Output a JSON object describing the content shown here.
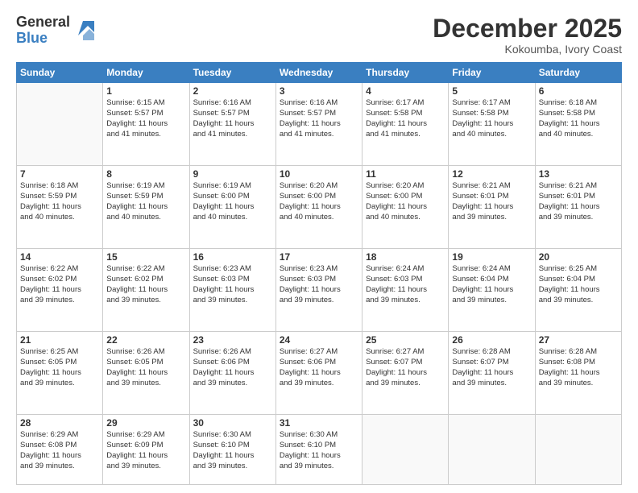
{
  "logo": {
    "general": "General",
    "blue": "Blue"
  },
  "header": {
    "month": "December 2025",
    "location": "Kokoumba, Ivory Coast"
  },
  "days_of_week": [
    "Sunday",
    "Monday",
    "Tuesday",
    "Wednesday",
    "Thursday",
    "Friday",
    "Saturday"
  ],
  "weeks": [
    [
      {
        "day": "",
        "lines": []
      },
      {
        "day": "1",
        "lines": [
          "Sunrise: 6:15 AM",
          "Sunset: 5:57 PM",
          "Daylight: 11 hours",
          "and 41 minutes."
        ]
      },
      {
        "day": "2",
        "lines": [
          "Sunrise: 6:16 AM",
          "Sunset: 5:57 PM",
          "Daylight: 11 hours",
          "and 41 minutes."
        ]
      },
      {
        "day": "3",
        "lines": [
          "Sunrise: 6:16 AM",
          "Sunset: 5:57 PM",
          "Daylight: 11 hours",
          "and 41 minutes."
        ]
      },
      {
        "day": "4",
        "lines": [
          "Sunrise: 6:17 AM",
          "Sunset: 5:58 PM",
          "Daylight: 11 hours",
          "and 41 minutes."
        ]
      },
      {
        "day": "5",
        "lines": [
          "Sunrise: 6:17 AM",
          "Sunset: 5:58 PM",
          "Daylight: 11 hours",
          "and 40 minutes."
        ]
      },
      {
        "day": "6",
        "lines": [
          "Sunrise: 6:18 AM",
          "Sunset: 5:58 PM",
          "Daylight: 11 hours",
          "and 40 minutes."
        ]
      }
    ],
    [
      {
        "day": "7",
        "lines": [
          "Sunrise: 6:18 AM",
          "Sunset: 5:59 PM",
          "Daylight: 11 hours",
          "and 40 minutes."
        ]
      },
      {
        "day": "8",
        "lines": [
          "Sunrise: 6:19 AM",
          "Sunset: 5:59 PM",
          "Daylight: 11 hours",
          "and 40 minutes."
        ]
      },
      {
        "day": "9",
        "lines": [
          "Sunrise: 6:19 AM",
          "Sunset: 6:00 PM",
          "Daylight: 11 hours",
          "and 40 minutes."
        ]
      },
      {
        "day": "10",
        "lines": [
          "Sunrise: 6:20 AM",
          "Sunset: 6:00 PM",
          "Daylight: 11 hours",
          "and 40 minutes."
        ]
      },
      {
        "day": "11",
        "lines": [
          "Sunrise: 6:20 AM",
          "Sunset: 6:00 PM",
          "Daylight: 11 hours",
          "and 40 minutes."
        ]
      },
      {
        "day": "12",
        "lines": [
          "Sunrise: 6:21 AM",
          "Sunset: 6:01 PM",
          "Daylight: 11 hours",
          "and 39 minutes."
        ]
      },
      {
        "day": "13",
        "lines": [
          "Sunrise: 6:21 AM",
          "Sunset: 6:01 PM",
          "Daylight: 11 hours",
          "and 39 minutes."
        ]
      }
    ],
    [
      {
        "day": "14",
        "lines": [
          "Sunrise: 6:22 AM",
          "Sunset: 6:02 PM",
          "Daylight: 11 hours",
          "and 39 minutes."
        ]
      },
      {
        "day": "15",
        "lines": [
          "Sunrise: 6:22 AM",
          "Sunset: 6:02 PM",
          "Daylight: 11 hours",
          "and 39 minutes."
        ]
      },
      {
        "day": "16",
        "lines": [
          "Sunrise: 6:23 AM",
          "Sunset: 6:03 PM",
          "Daylight: 11 hours",
          "and 39 minutes."
        ]
      },
      {
        "day": "17",
        "lines": [
          "Sunrise: 6:23 AM",
          "Sunset: 6:03 PM",
          "Daylight: 11 hours",
          "and 39 minutes."
        ]
      },
      {
        "day": "18",
        "lines": [
          "Sunrise: 6:24 AM",
          "Sunset: 6:03 PM",
          "Daylight: 11 hours",
          "and 39 minutes."
        ]
      },
      {
        "day": "19",
        "lines": [
          "Sunrise: 6:24 AM",
          "Sunset: 6:04 PM",
          "Daylight: 11 hours",
          "and 39 minutes."
        ]
      },
      {
        "day": "20",
        "lines": [
          "Sunrise: 6:25 AM",
          "Sunset: 6:04 PM",
          "Daylight: 11 hours",
          "and 39 minutes."
        ]
      }
    ],
    [
      {
        "day": "21",
        "lines": [
          "Sunrise: 6:25 AM",
          "Sunset: 6:05 PM",
          "Daylight: 11 hours",
          "and 39 minutes."
        ]
      },
      {
        "day": "22",
        "lines": [
          "Sunrise: 6:26 AM",
          "Sunset: 6:05 PM",
          "Daylight: 11 hours",
          "and 39 minutes."
        ]
      },
      {
        "day": "23",
        "lines": [
          "Sunrise: 6:26 AM",
          "Sunset: 6:06 PM",
          "Daylight: 11 hours",
          "and 39 minutes."
        ]
      },
      {
        "day": "24",
        "lines": [
          "Sunrise: 6:27 AM",
          "Sunset: 6:06 PM",
          "Daylight: 11 hours",
          "and 39 minutes."
        ]
      },
      {
        "day": "25",
        "lines": [
          "Sunrise: 6:27 AM",
          "Sunset: 6:07 PM",
          "Daylight: 11 hours",
          "and 39 minutes."
        ]
      },
      {
        "day": "26",
        "lines": [
          "Sunrise: 6:28 AM",
          "Sunset: 6:07 PM",
          "Daylight: 11 hours",
          "and 39 minutes."
        ]
      },
      {
        "day": "27",
        "lines": [
          "Sunrise: 6:28 AM",
          "Sunset: 6:08 PM",
          "Daylight: 11 hours",
          "and 39 minutes."
        ]
      }
    ],
    [
      {
        "day": "28",
        "lines": [
          "Sunrise: 6:29 AM",
          "Sunset: 6:08 PM",
          "Daylight: 11 hours",
          "and 39 minutes."
        ]
      },
      {
        "day": "29",
        "lines": [
          "Sunrise: 6:29 AM",
          "Sunset: 6:09 PM",
          "Daylight: 11 hours",
          "and 39 minutes."
        ]
      },
      {
        "day": "30",
        "lines": [
          "Sunrise: 6:30 AM",
          "Sunset: 6:10 PM",
          "Daylight: 11 hours",
          "and 39 minutes."
        ]
      },
      {
        "day": "31",
        "lines": [
          "Sunrise: 6:30 AM",
          "Sunset: 6:10 PM",
          "Daylight: 11 hours",
          "and 39 minutes."
        ]
      },
      {
        "day": "",
        "lines": []
      },
      {
        "day": "",
        "lines": []
      },
      {
        "day": "",
        "lines": []
      }
    ]
  ]
}
